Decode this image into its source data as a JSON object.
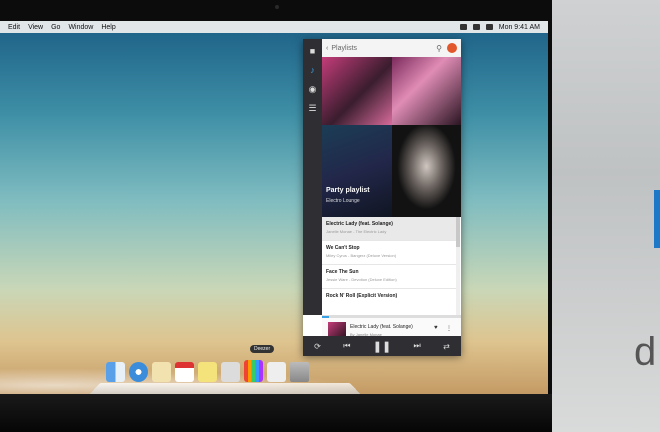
{
  "menubar": {
    "items": [
      "Edit",
      "View",
      "Go",
      "Window",
      "Help"
    ],
    "clock": "Mon 9:41 AM"
  },
  "player": {
    "header_title": "Playlists",
    "playlist_title": "Party playlist",
    "playlist_owner": "Electro Lounge",
    "tracks": [
      {
        "title": "Electric Lady (feat. Solange)",
        "subtitle": "Janelle Monae - The Electric Lady"
      },
      {
        "title": "We Can't Stop",
        "subtitle": "Miley Cyrus - Bangerz (Deluxe Version)"
      },
      {
        "title": "Face The Sun",
        "subtitle": "Jessie Ware - Devotion (Deluxe Edition)"
      },
      {
        "title": "Rock N' Roll (Explicit Version)",
        "subtitle": ""
      }
    ],
    "now_playing": {
      "title": "Electric Lady (feat. Solange)",
      "artist": "By Janelle Monae",
      "progress": 0.05
    },
    "rail_icons": [
      "library-icon",
      "music-note-icon",
      "radio-icon",
      "queue-list-icon"
    ],
    "control_icons": [
      "repeat-icon",
      "previous-icon",
      "pause-icon",
      "next-icon",
      "shuffle-icon"
    ]
  },
  "dock": {
    "tooltip": "Deezer",
    "icons": [
      "finder-icon",
      "safari-icon",
      "notes-icon",
      "calendar-icon",
      "stickies-icon",
      "app-icon",
      "deezer-icon",
      "preview-icon",
      "trash-icon"
    ]
  },
  "background": {
    "right_letter": "d",
    "accent": "#1e78c8"
  }
}
